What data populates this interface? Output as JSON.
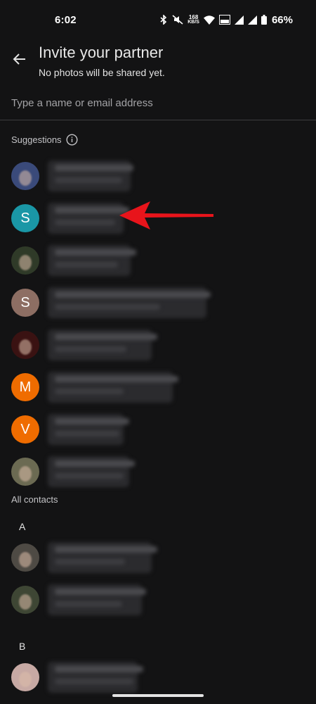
{
  "status": {
    "time": "6:02",
    "network_speed": "168",
    "network_speed_unit": "KB/S",
    "battery_percent": "66%"
  },
  "header": {
    "title": "Invite your partner",
    "subtitle": "No photos will be shared yet."
  },
  "search": {
    "placeholder": "Type a name or email address"
  },
  "suggestions": {
    "label": "Suggestions",
    "items": [
      {
        "avatar_type": "photo",
        "avatar_color": "#3a4a7a"
      },
      {
        "avatar_type": "letter",
        "letter": "S",
        "avatar_color": "#1a97a6"
      },
      {
        "avatar_type": "photo",
        "avatar_color": "#2f3a28"
      },
      {
        "avatar_type": "letter",
        "letter": "S",
        "avatar_color": "#8d6e63"
      },
      {
        "avatar_type": "photo",
        "avatar_color": "#3a1212"
      },
      {
        "avatar_type": "letter",
        "letter": "M",
        "avatar_color": "#ef6c00"
      },
      {
        "avatar_type": "letter",
        "letter": "V",
        "avatar_color": "#ef6c00"
      },
      {
        "avatar_type": "photo",
        "avatar_color": "#6b6a52"
      }
    ]
  },
  "all_contacts": {
    "label": "All contacts",
    "groups": [
      {
        "letter": "A",
        "items": [
          {
            "avatar_type": "photo",
            "avatar_color": "#4e4a44"
          },
          {
            "avatar_type": "photo",
            "avatar_color": "#3e4634"
          }
        ]
      },
      {
        "letter": "B",
        "items": [
          {
            "avatar_type": "photo",
            "avatar_color": "#c7a9a4"
          }
        ]
      }
    ]
  },
  "colors": {
    "background": "#131314",
    "annotation_arrow": "#e8141b"
  }
}
